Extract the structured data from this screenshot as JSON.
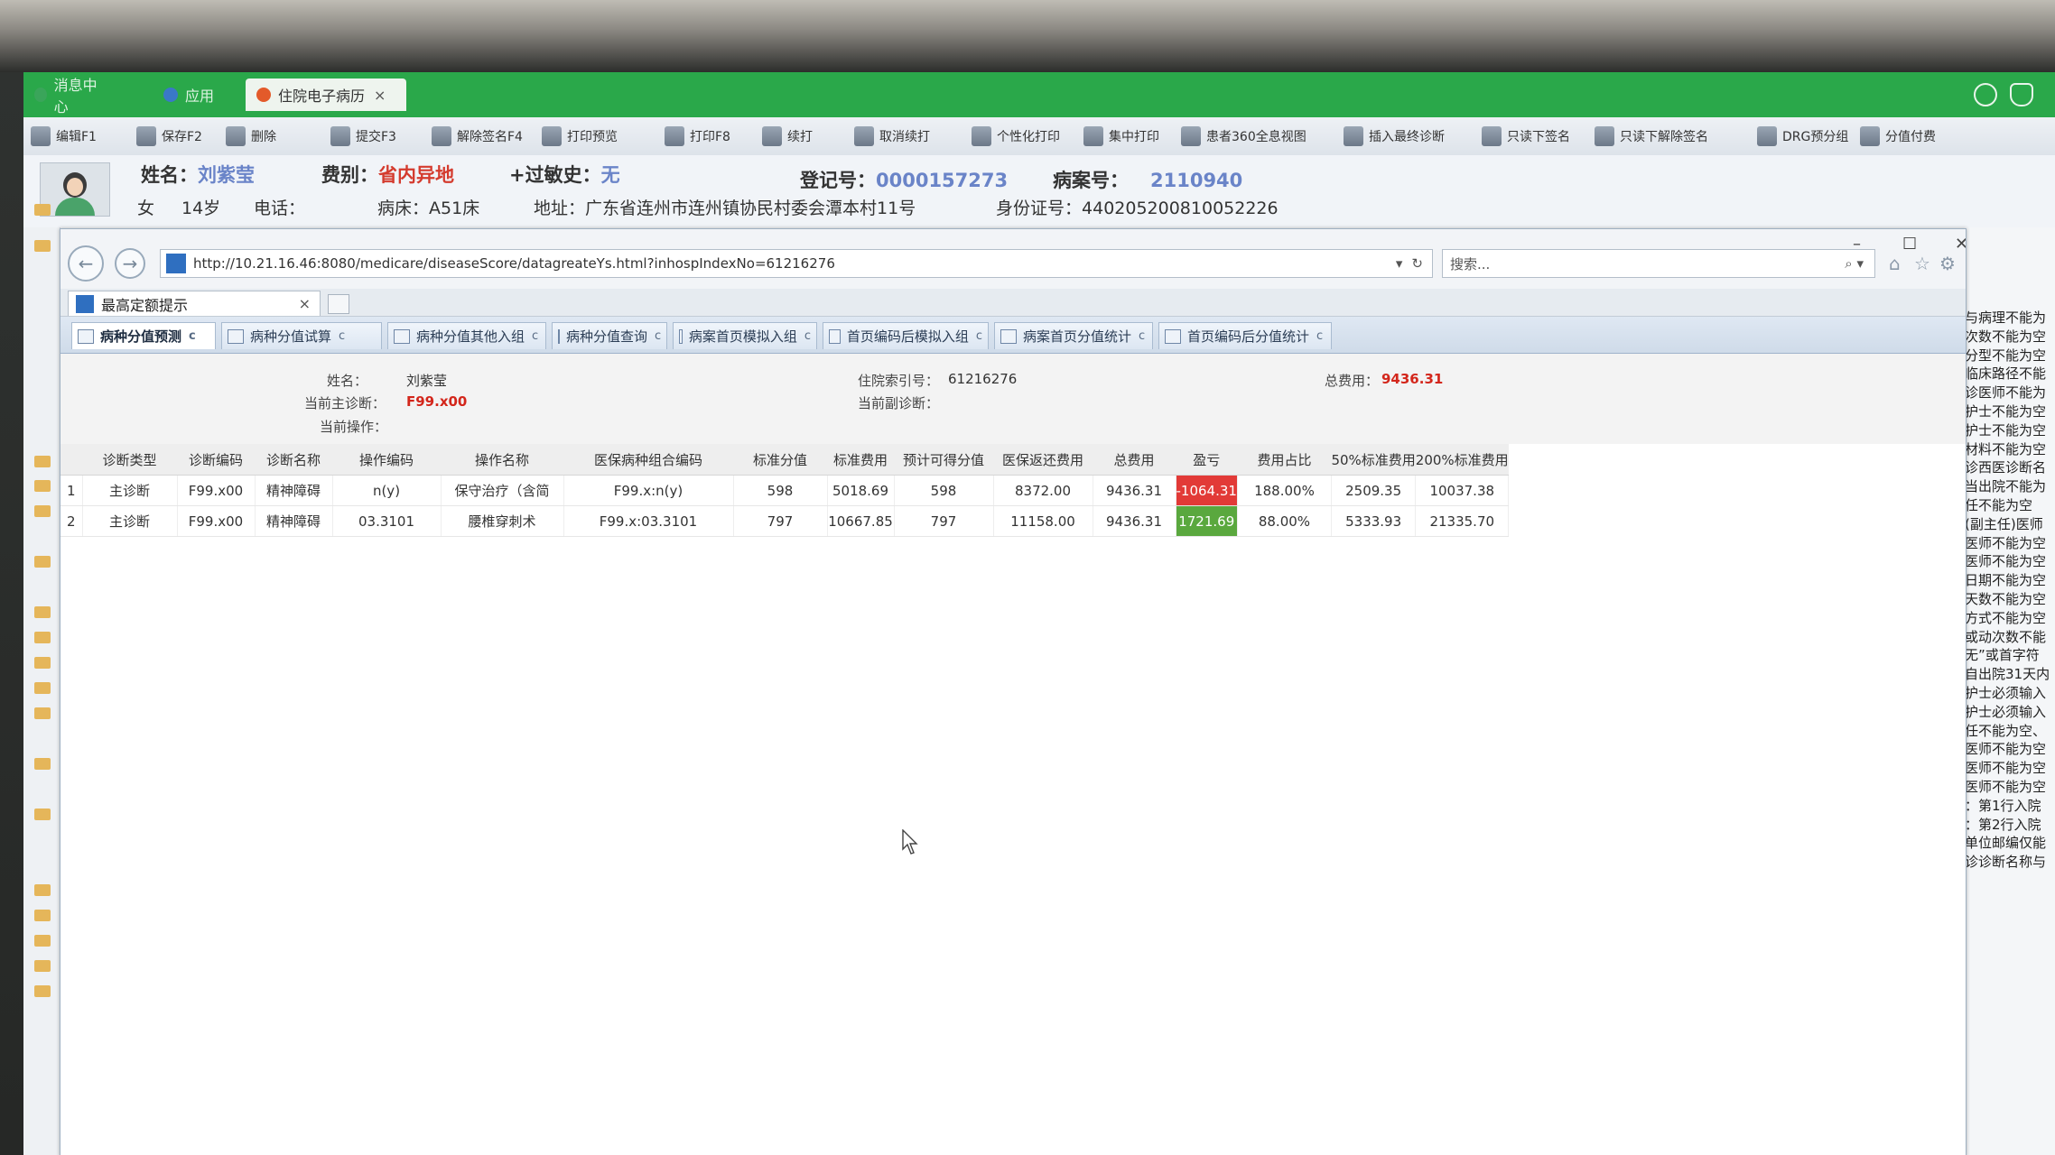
{
  "app_tabs": [
    {
      "label": "消息中心",
      "color": "#3aa55a"
    },
    {
      "label": "应用",
      "color": "#3a78c8"
    },
    {
      "label": "住院电子病历",
      "color": "#e35a2a",
      "close": "×"
    }
  ],
  "toolbar": [
    "编辑F1",
    "保存F2",
    "删除",
    "提交F3",
    "解除签名F4",
    "打印预览",
    "打印F8",
    "续打",
    "取消续打",
    "个性化打印",
    "集中打印",
    "患者360全息视图",
    "插入最终诊断",
    "只读下签名",
    "只读下解除签名",
    "DRG预分组",
    "分值付费"
  ],
  "patient": {
    "name_label": "姓名：",
    "name": "刘紫莹",
    "fee_label": "费别：",
    "fee": "省内异地",
    "allergy_label": "+过敏史：",
    "allergy": "无",
    "reg_label": "登记号：",
    "reg": "0000157273",
    "case_label": "病案号：",
    "case": "2110940",
    "gender": "女",
    "age": "14岁",
    "phone_label": "电话：",
    "bed_label": "病床：",
    "bed": "A51床",
    "addr_label": "地址：",
    "addr": "广东省连州市连州镇协民村委会潭本村11号",
    "id_label": "身份证号：",
    "id": "440205200810052226"
  },
  "browser": {
    "url": "http://10.21.16.46:8080/medicare/diseaseScore/datagreateYs.html?inhospIndexNo=61216276",
    "search_placeholder": "搜索...",
    "tab_title": "最高定额提示",
    "tab_close": "×"
  },
  "page_tabs": [
    "病种分值预测",
    "病种分值试算",
    "病种分值其他入组",
    "病种分值查询",
    "病案首页模拟入组",
    "首页编码后模拟入组",
    "病案首页分值统计",
    "首页编码后分值统计"
  ],
  "info": {
    "name_label": "姓名：",
    "name": "刘紫莹",
    "index_label": "住院索引号：",
    "index": "61216276",
    "total_label": "总费用：",
    "total": "9436.31",
    "main_dx_label": "当前主诊断：",
    "main_dx": "F99.x00",
    "sec_dx_label": "当前副诊断：",
    "op_label": "当前操作："
  },
  "table": {
    "headers": [
      "",
      "诊断类型",
      "诊断编码",
      "诊断名称",
      "操作编码",
      "操作名称",
      "医保病种组合编码",
      "标准分值",
      "标准费用",
      "预计可得分值",
      "医保返还费用",
      "总费用",
      "盈亏",
      "费用占比",
      "50%标准费用",
      "200%标准费用"
    ],
    "rows": [
      [
        "1",
        "主诊断",
        "F99.x00",
        "精神障碍",
        "n(y)",
        "保守治疗（含简",
        "F99.x:n(y)",
        "598",
        "5018.69",
        "598",
        "8372.00",
        "9436.31",
        "-1064.31",
        "188.00%",
        "2509.35",
        "10037.38"
      ],
      [
        "2",
        "主诊断",
        "F99.x00",
        "精神障碍",
        "03.3101",
        "腰椎穿刺术",
        "F99.x:03.3101",
        "797",
        "10667.85",
        "797",
        "11158.00",
        "9436.31",
        "1721.69",
        "88.00%",
        "5333.93",
        "21335.70"
      ]
    ]
  },
  "right_panel": [
    "与病理不能为",
    "次数不能为空",
    "分型不能为空",
    "临床路径不能",
    "诊医师不能为",
    "护士不能为空",
    "护士不能为空",
    "材料不能为空",
    "诊西医诊断名",
    "当出院不能为",
    "任不能为空",
    "(副主任)医师",
    "医师不能为空",
    "医师不能为空",
    "日期不能为空",
    "天数不能为空",
    "方式不能为空",
    "或动次数不能",
    "无”或首字符",
    "自出院31天内",
    "护士必须输入",
    "护士必须输入",
    "任不能为空、",
    "医师不能为空",
    "医师不能为空",
    "医师不能为空",
    "：第1行入院",
    "：第2行入院",
    "单位邮编仅能",
    "诊诊断名称与"
  ]
}
